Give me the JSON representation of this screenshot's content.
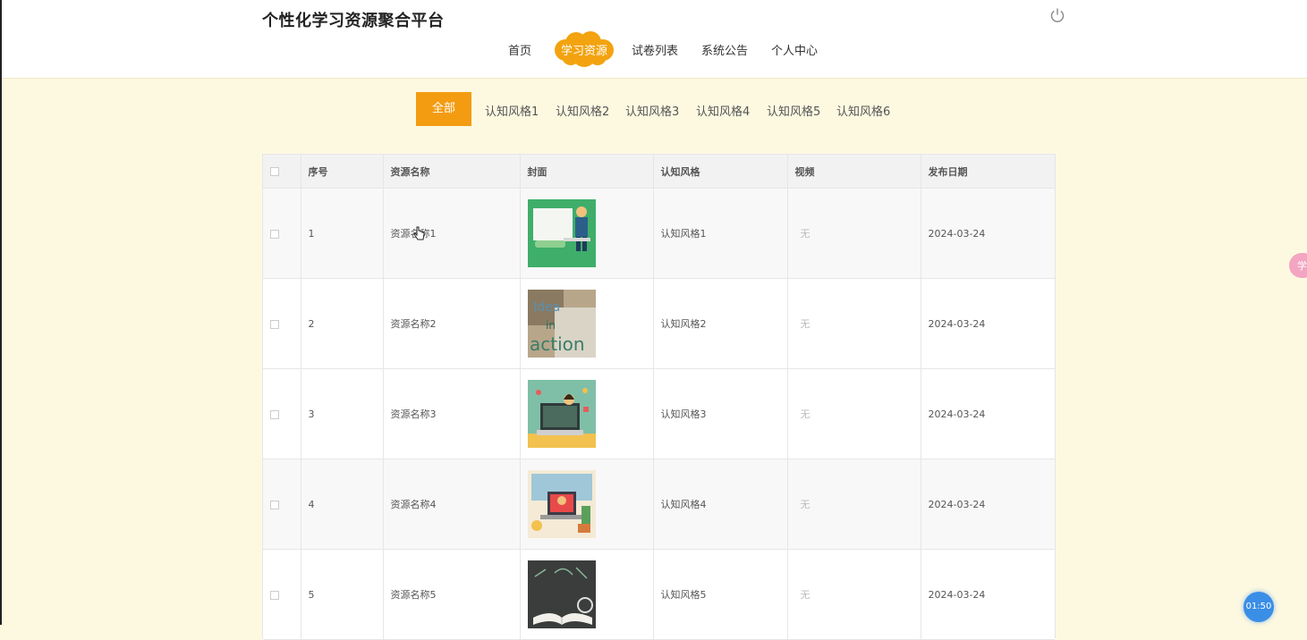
{
  "header": {
    "site_title": "个性化学习资源聚合平台",
    "power_icon": "power-icon"
  },
  "nav": {
    "items": [
      {
        "label": "首页"
      },
      {
        "label": "学习资源",
        "active": true
      },
      {
        "label": "试卷列表"
      },
      {
        "label": "系统公告"
      },
      {
        "label": "个人中心"
      }
    ],
    "active_color": "#f3a30f"
  },
  "filters": {
    "all_label": "全部",
    "items": [
      "认知风格1",
      "认知风格2",
      "认知风格3",
      "认知风格4",
      "认知风格5",
      "认知风格6"
    ],
    "accent_color": "#f39c12"
  },
  "table": {
    "headers": [
      "序号",
      "资源名称",
      "封面",
      "认知风格",
      "视频",
      "发布日期"
    ],
    "rows": [
      {
        "index": "1",
        "name": "资源名称1",
        "cover": "teacher-whiteboard-image",
        "style": "认知风格1",
        "video": "无",
        "date": "2024-03-24"
      },
      {
        "index": "2",
        "name": "资源名称2",
        "cover": "idea-action-image",
        "style": "认知风格2",
        "video": "无",
        "date": "2024-03-24"
      },
      {
        "index": "3",
        "name": "资源名称3",
        "cover": "teacher-laptop-image",
        "style": "认知风格3",
        "video": "无",
        "date": "2024-03-24"
      },
      {
        "index": "4",
        "name": "资源名称4",
        "cover": "online-class-image",
        "style": "认知风格4",
        "video": "无",
        "date": "2024-03-24"
      },
      {
        "index": "5",
        "name": "资源名称5",
        "cover": "chalkboard-book-image",
        "style": "认知风格5",
        "video": "无",
        "date": "2024-03-24"
      }
    ]
  },
  "widgets": {
    "timer": "01:50",
    "float_tab_label": "学"
  }
}
